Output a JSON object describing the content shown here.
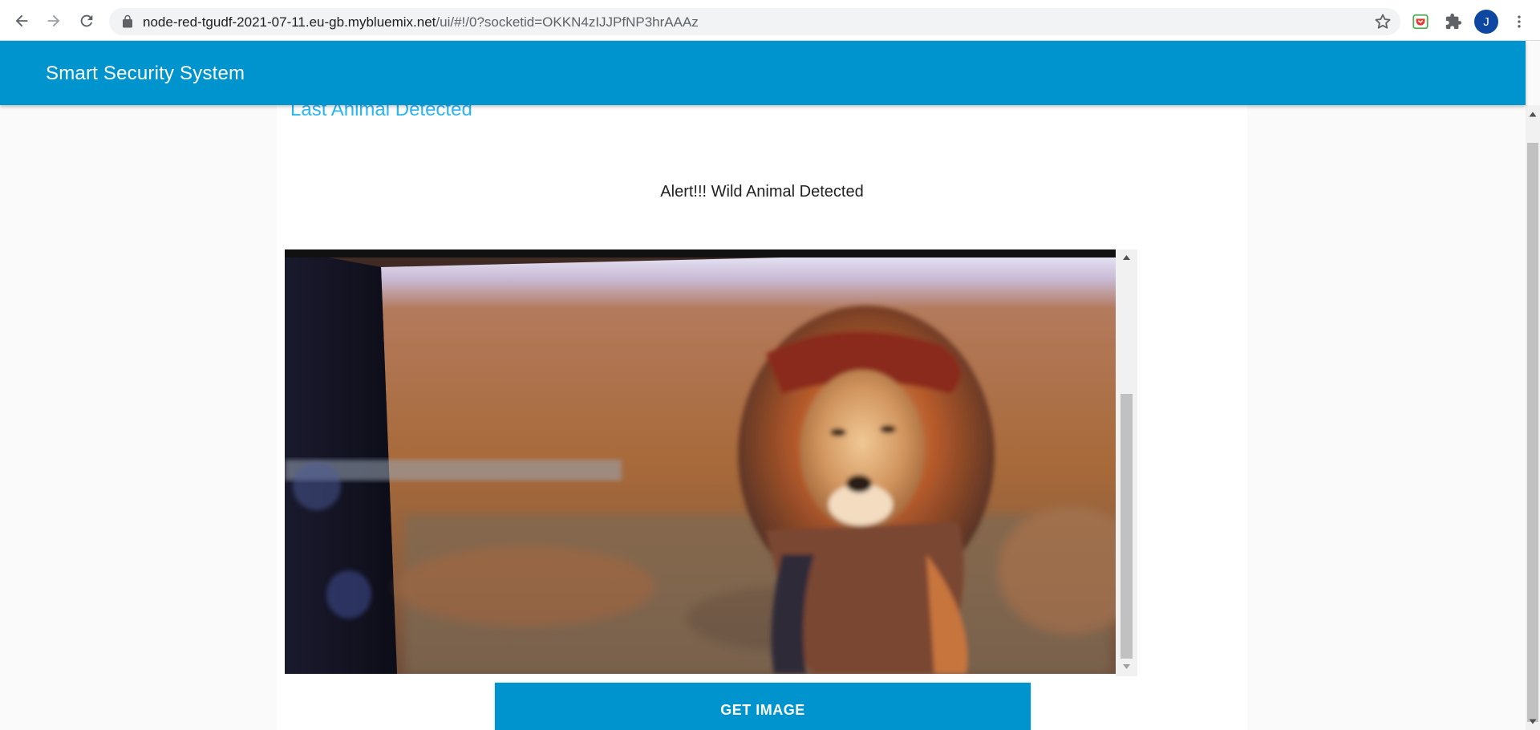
{
  "browser": {
    "url_host": "node-red-tgudf-2021-07-11.eu-gb.mybluemix.net",
    "url_path": "/ui/#!/0?socketid=OKKN4zIJJPfNP3hrAAAz",
    "profile_initial": "J"
  },
  "header": {
    "title": "Smart Security System"
  },
  "main": {
    "group_title": "Last Animal Detected",
    "alert_text": "Alert!!! Wild Animal Detected",
    "get_image_label": "GET IMAGE"
  },
  "colors": {
    "header_bg": "#0094ce",
    "group_title": "#29b6f6",
    "button_bg": "#0094ce"
  }
}
